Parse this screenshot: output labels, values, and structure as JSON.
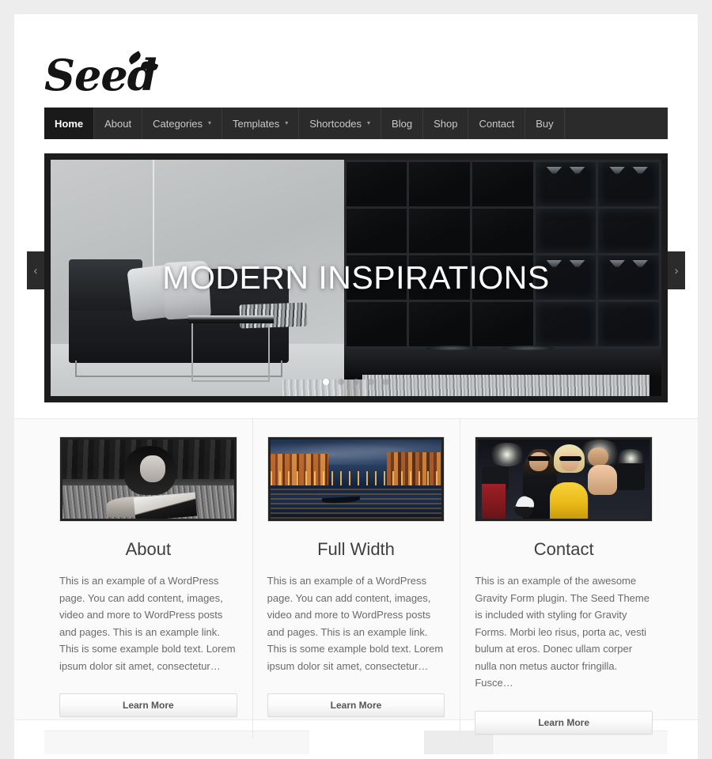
{
  "site": {
    "logo_text": "Seed"
  },
  "nav": {
    "items": [
      {
        "label": "Home",
        "has_dropdown": false,
        "active": true
      },
      {
        "label": "About",
        "has_dropdown": false,
        "active": false
      },
      {
        "label": "Categories",
        "has_dropdown": true,
        "active": false
      },
      {
        "label": "Templates",
        "has_dropdown": true,
        "active": false
      },
      {
        "label": "Shortcodes",
        "has_dropdown": true,
        "active": false
      },
      {
        "label": "Blog",
        "has_dropdown": false,
        "active": false
      },
      {
        "label": "Shop",
        "has_dropdown": false,
        "active": false
      },
      {
        "label": "Contact",
        "has_dropdown": false,
        "active": false
      },
      {
        "label": "Buy",
        "has_dropdown": false,
        "active": false
      }
    ],
    "caret_glyph": "▾"
  },
  "slider": {
    "caption": "MODERN INSPIRATIONS",
    "prev_glyph": "‹",
    "next_glyph": "›",
    "slide_count": 5,
    "active_slide": 1,
    "scene_description": "Minimalist dark living room with black sofa, chrome side table and black grid shelving"
  },
  "features": [
    {
      "title": "About",
      "image_description": "Black and white photo of a woman reading a book in grass",
      "text": "This is an example of a WordPress page. You can add content, images, video and more to WordPress posts and pages. This is an example link. This is some example bold text. Lorem ipsum dolor sit amet, consectetur…",
      "button_label": "Learn More"
    },
    {
      "title": "Full Width",
      "image_description": "Venice Grand Canal at dusk with warm lights and a gondola",
      "text": "This is an example of a WordPress page. You can add content, images, video and more to WordPress posts and pages. This is an example link. This is some example bold text. Lorem ipsum dolor sit amet, consectetur…",
      "button_label": "Learn More"
    },
    {
      "title": "Contact",
      "image_description": "Paparazzi photographing a blonde woman in a yellow top",
      "text": "This is an example of the awesome Gravity Form plugin. The Seed Theme is included with styling for Gravity Forms. Morbi leo risus, porta ac, vesti bulum at eros. Donec ullam corper nulla non metus auctor fringilla. Fusce…",
      "button_label": "Learn More"
    }
  ],
  "colors": {
    "page_background": "#ededed",
    "content_background": "#ffffff",
    "nav_background": "#2b2b2b",
    "nav_active_background": "#1a1a1a",
    "slider_frame": "#1c1c1c",
    "features_background": "#fafafa",
    "heading_text": "#3f3f3f",
    "body_text": "#6a6a6a",
    "button_text": "#555555"
  }
}
